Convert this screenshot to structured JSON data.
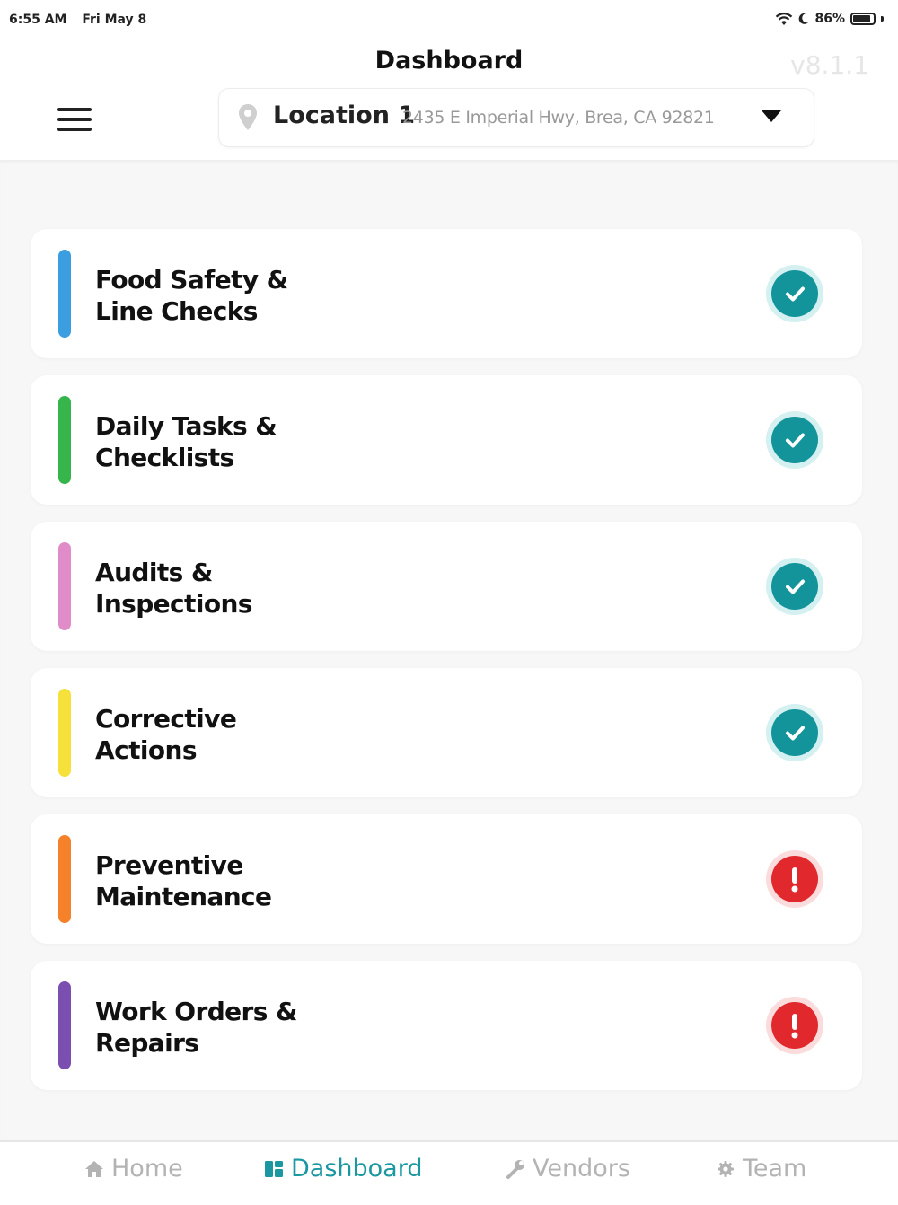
{
  "status_bar": {
    "time": "6:55 AM",
    "date": "Fri May 8",
    "battery": "86%",
    "battery_level": 0.86
  },
  "header": {
    "title": "Dashboard",
    "version": "v8.1.1"
  },
  "location": {
    "name": "Location 1",
    "address": "2435 E Imperial Hwy, Brea, CA 92821"
  },
  "cards": [
    {
      "line1": "Food Safety &",
      "line2": "Line Checks",
      "color": "#3a9ee0",
      "status": "ok"
    },
    {
      "line1": "Daily Tasks &",
      "line2": "Checklists",
      "color": "#35b54a",
      "status": "ok"
    },
    {
      "line1": "Audits &",
      "line2": "Inspections",
      "color": "#e08cc8",
      "status": "ok"
    },
    {
      "line1": "Corrective",
      "line2": "Actions",
      "color": "#f6e03a",
      "status": "ok"
    },
    {
      "line1": "Preventive",
      "line2": "Maintenance",
      "color": "#f5822a",
      "status": "alert"
    },
    {
      "line1": "Work Orders &",
      "line2": "Repairs",
      "color": "#7b4fb0",
      "status": "alert"
    }
  ],
  "tabs": [
    {
      "label": "Home",
      "icon": "home-icon",
      "active": false
    },
    {
      "label": "Dashboard",
      "icon": "dashboard-icon",
      "active": true
    },
    {
      "label": "Vendors",
      "icon": "wrench-icon",
      "active": false
    },
    {
      "label": "Team",
      "icon": "gear-icon",
      "active": false
    }
  ],
  "colors": {
    "accent": "#1a97a1",
    "ok": "#13949a",
    "alert": "#e1282d"
  }
}
